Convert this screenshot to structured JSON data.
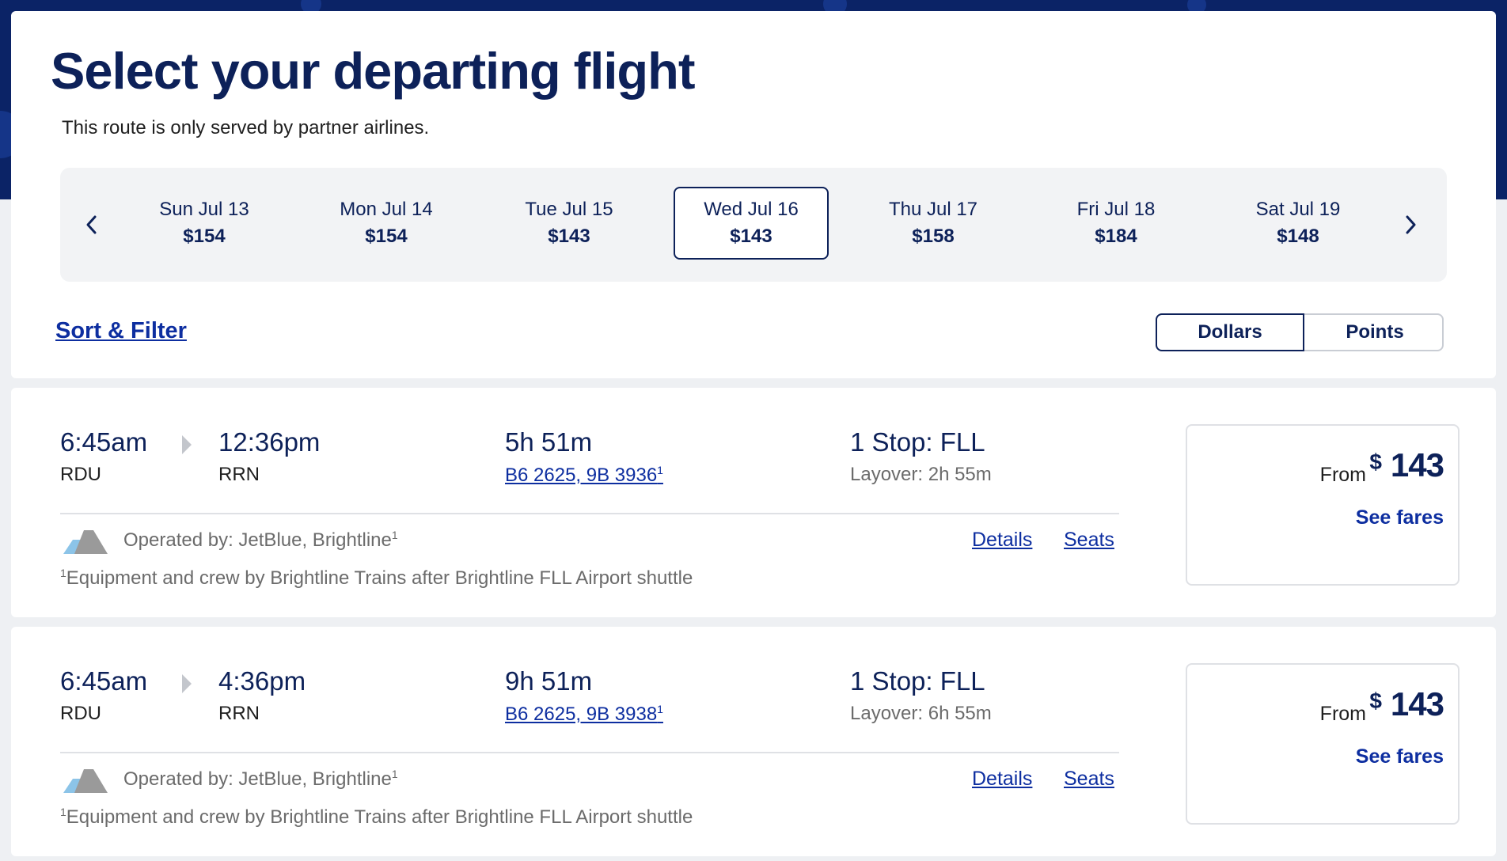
{
  "header": {
    "title": "Select your departing flight",
    "subtitle": "This route is only served by partner airlines."
  },
  "date_strip": {
    "prev_icon": "chevron-left-icon",
    "next_icon": "chevron-right-icon",
    "dates": [
      {
        "day": "Sun Jul 13",
        "price": "$154",
        "selected": false
      },
      {
        "day": "Mon Jul 14",
        "price": "$154",
        "selected": false
      },
      {
        "day": "Tue Jul 15",
        "price": "$143",
        "selected": false
      },
      {
        "day": "Wed Jul 16",
        "price": "$143",
        "selected": true
      },
      {
        "day": "Thu Jul 17",
        "price": "$158",
        "selected": false
      },
      {
        "day": "Fri Jul 18",
        "price": "$184",
        "selected": false
      },
      {
        "day": "Sat Jul 19",
        "price": "$148",
        "selected": false
      }
    ]
  },
  "controls": {
    "sort_filter_label": "Sort & Filter",
    "toggle": {
      "dollars_label": "Dollars",
      "points_label": "Points",
      "selected": "Dollars"
    }
  },
  "flights": [
    {
      "depart_time": "6:45am",
      "depart_code": "RDU",
      "arrive_time": "12:36pm",
      "arrive_code": "RRN",
      "duration": "5h 51m",
      "flight_numbers": "B6 2625, 9B 3936",
      "flight_numbers_sup": "1",
      "stops": "1 Stop: FLL",
      "layover": "Layover: 2h 55m",
      "operated_by": "Operated by: JetBlue, Brightline",
      "operated_sup": "1",
      "details_label": "Details",
      "seats_label": "Seats",
      "footnote_sup": "1",
      "footnote": "Equipment and crew by Brightline Trains after Brightline FLL Airport shuttle",
      "fare_from": "From",
      "fare_currency": "$",
      "fare_amount": "143",
      "see_fares_label": "See fares"
    },
    {
      "depart_time": "6:45am",
      "depart_code": "RDU",
      "arrive_time": "4:36pm",
      "arrive_code": "RRN",
      "duration": "9h 51m",
      "flight_numbers": "B6 2625, 9B 3938",
      "flight_numbers_sup": "1",
      "stops": "1 Stop: FLL",
      "layover": "Layover: 6h 55m",
      "operated_by": "Operated by: JetBlue, Brightline",
      "operated_sup": "1",
      "details_label": "Details",
      "seats_label": "Seats",
      "footnote_sup": "1",
      "footnote": "Equipment and crew by Brightline Trains after Brightline FLL Airport shuttle",
      "fare_from": "From",
      "fare_currency": "$",
      "fare_amount": "143",
      "see_fares_label": "See fares"
    }
  ],
  "colors": {
    "brand_navy": "#0d2159",
    "link_blue": "#0d2ea0",
    "top_band": "#0b2366",
    "strip_bg": "#f2f3f5"
  }
}
